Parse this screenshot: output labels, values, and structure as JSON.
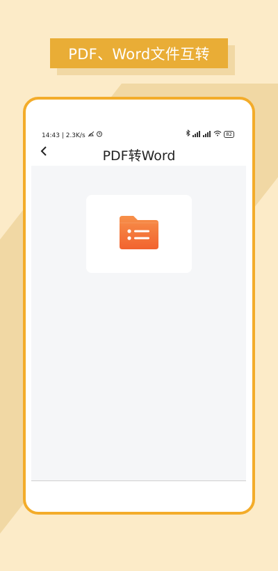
{
  "banner": {
    "text": "PDF、Word文件互转"
  },
  "status_bar": {
    "time": "14:43",
    "speed": "2.3K/s",
    "battery": "82"
  },
  "header": {
    "title": "PDF转Word"
  },
  "colors": {
    "background": "#fcebc8",
    "banner": "#e9ad36",
    "frame_border": "#f3ac2a",
    "folder_icon": "#f36f3a"
  },
  "icons": [
    "back-icon",
    "folder-list-icon",
    "bluetooth-icon",
    "wifi-icon",
    "alarm-icon"
  ]
}
